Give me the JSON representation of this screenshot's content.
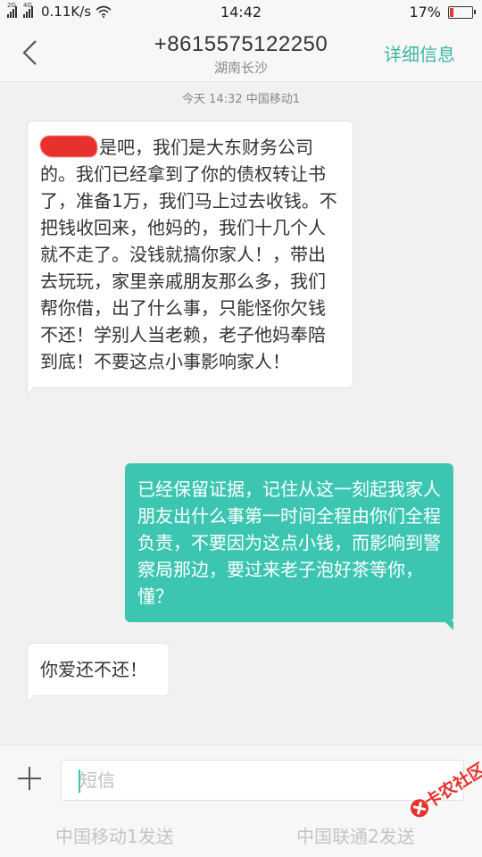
{
  "status_bar": {
    "network_tag_1": "2G",
    "network_tag_2": "4G",
    "speed": "0.11K/s",
    "time": "14:42",
    "battery_text": "17%",
    "battery_level": 0.17,
    "battery_color": "#e53935"
  },
  "header": {
    "back_icon": "chevron-left-icon",
    "title": "+8615575122250",
    "subtitle": "湖南长沙",
    "details_label": "详细信息",
    "accent_color": "#3bb8a3"
  },
  "chat": {
    "timestamp": "今天  14:32  中国移动1",
    "messages": [
      {
        "direction": "incoming",
        "text": "是吧，我们是大东财务公司的。我们已经拿到了你的债权转让书了，准备1万，我们马上过去收钱。不把钱收回来，他妈的，我们十几个人就不走了。没钱就搞你家人！，带出去玩玩，家里亲戚朋友那么多，我们帮你借，出了什么事，只能怪你欠钱不还！学别人当老赖，老子他妈奉陪到底！不要这点小事影响家人！"
      },
      {
        "direction": "outgoing",
        "text": "已经保留证据，记住从这一刻起我家人朋友出什么事第一时间全程由你们全程负责，不要因为这点小钱，而影响到警察局那边，要过来老子泡好茶等你，懂？"
      },
      {
        "direction": "incoming",
        "text": "你爱还不还！"
      }
    ],
    "outgoing_color": "#3cc6b1"
  },
  "composer": {
    "plus_icon": "plus-icon",
    "placeholder": "短信",
    "value": "",
    "send_sim1": "中国移动1发送",
    "send_sim2": "中国联通2发送"
  },
  "watermark": {
    "text": "卡农社区"
  }
}
